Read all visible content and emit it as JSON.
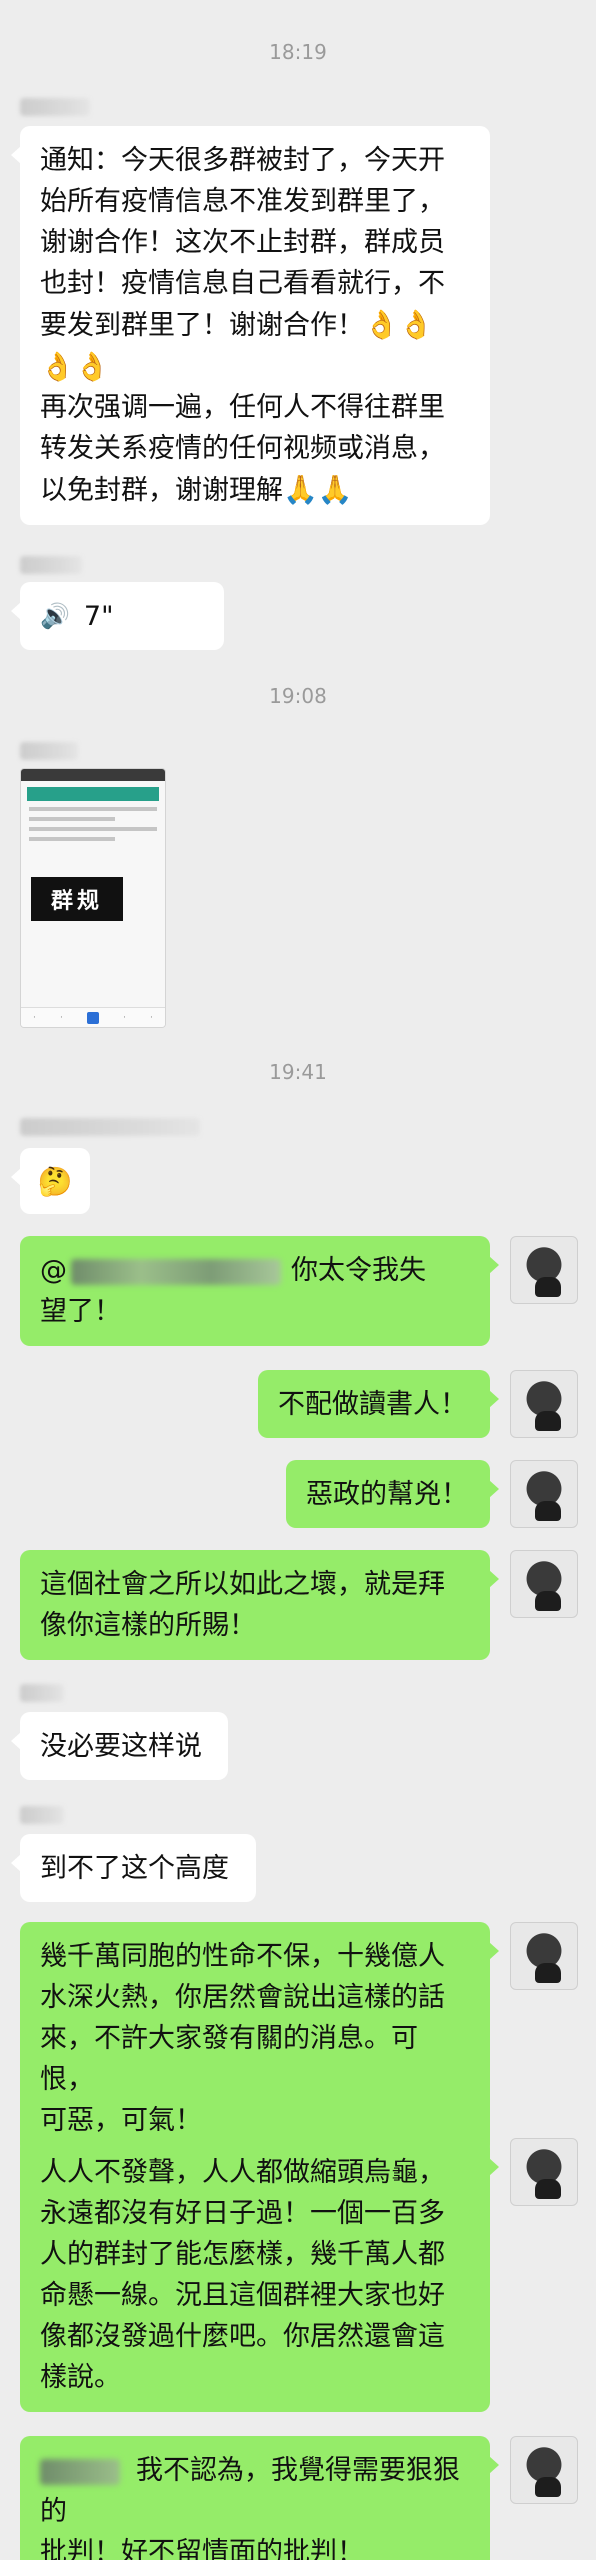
{
  "timestamps": {
    "t1": "18:19",
    "t2": "19:08",
    "t3": "19:41"
  },
  "messages": {
    "notice": {
      "line1": "通知：今天很多群被封了，今天开",
      "line2": "始所有疫情信息不准发到群里了，",
      "line3": "谢谢合作！这次不止封群，群成员",
      "line4": "也封！疫情信息自己看看就行，不",
      "line5": "要发到群里了！谢谢合作！",
      "line5_emoji": "👌👌",
      "line6_emoji": "👌👌",
      "line7": "再次强调一遍，任何人不得往群里",
      "line8": "转发关系疫情的任何视频或消息，",
      "line9": "以免封群，谢谢理解",
      "line9_emoji": "🙏🙏"
    },
    "voice": {
      "icon": "voice-wave-icon",
      "glyph": "🔊",
      "duration": "7\""
    },
    "image": {
      "stamp_text": "群规"
    },
    "emoji_msg": {
      "glyph": "🤔"
    },
    "out1": {
      "at": "@",
      "line1_tail": "你太令我失",
      "line2": "望了！"
    },
    "out2": {
      "text": "不配做讀書人！"
    },
    "out3": {
      "text": "惡政的幫兇！"
    },
    "out4": {
      "line1": "這個社會之所以如此之壞，就是拜",
      "line2": "像你這樣的所賜！"
    },
    "in1": {
      "text": "没必要这样说"
    },
    "in2": {
      "text": "到不了这个高度"
    },
    "out5": {
      "line1": "幾千萬同胞的性命不保，十幾億人",
      "line2": "水深火熱，你居然會說出這樣的話",
      "line3": "來，不許大家發有關的消息。可恨，",
      "line4": "可惡，可氣！"
    },
    "out6": {
      "line1": "人人不發聲，人人都做縮頭烏龜，",
      "line2": "永遠都沒有好日子過！一個一百多",
      "line3": "人的群封了能怎麼樣，幾千萬人都",
      "line4": "命懸一線。況且這個群裡大家也好",
      "line5": "像都沒發過什麼吧。你居然還會這",
      "line6": "樣說。"
    },
    "out7": {
      "line1_tail": "我不認為，我覺得需要狠狠的",
      "line2": "批判！好不留情面的批判！"
    }
  },
  "colors": {
    "background": "#ededed",
    "incoming": "#ffffff",
    "outgoing": "#95ec69"
  }
}
